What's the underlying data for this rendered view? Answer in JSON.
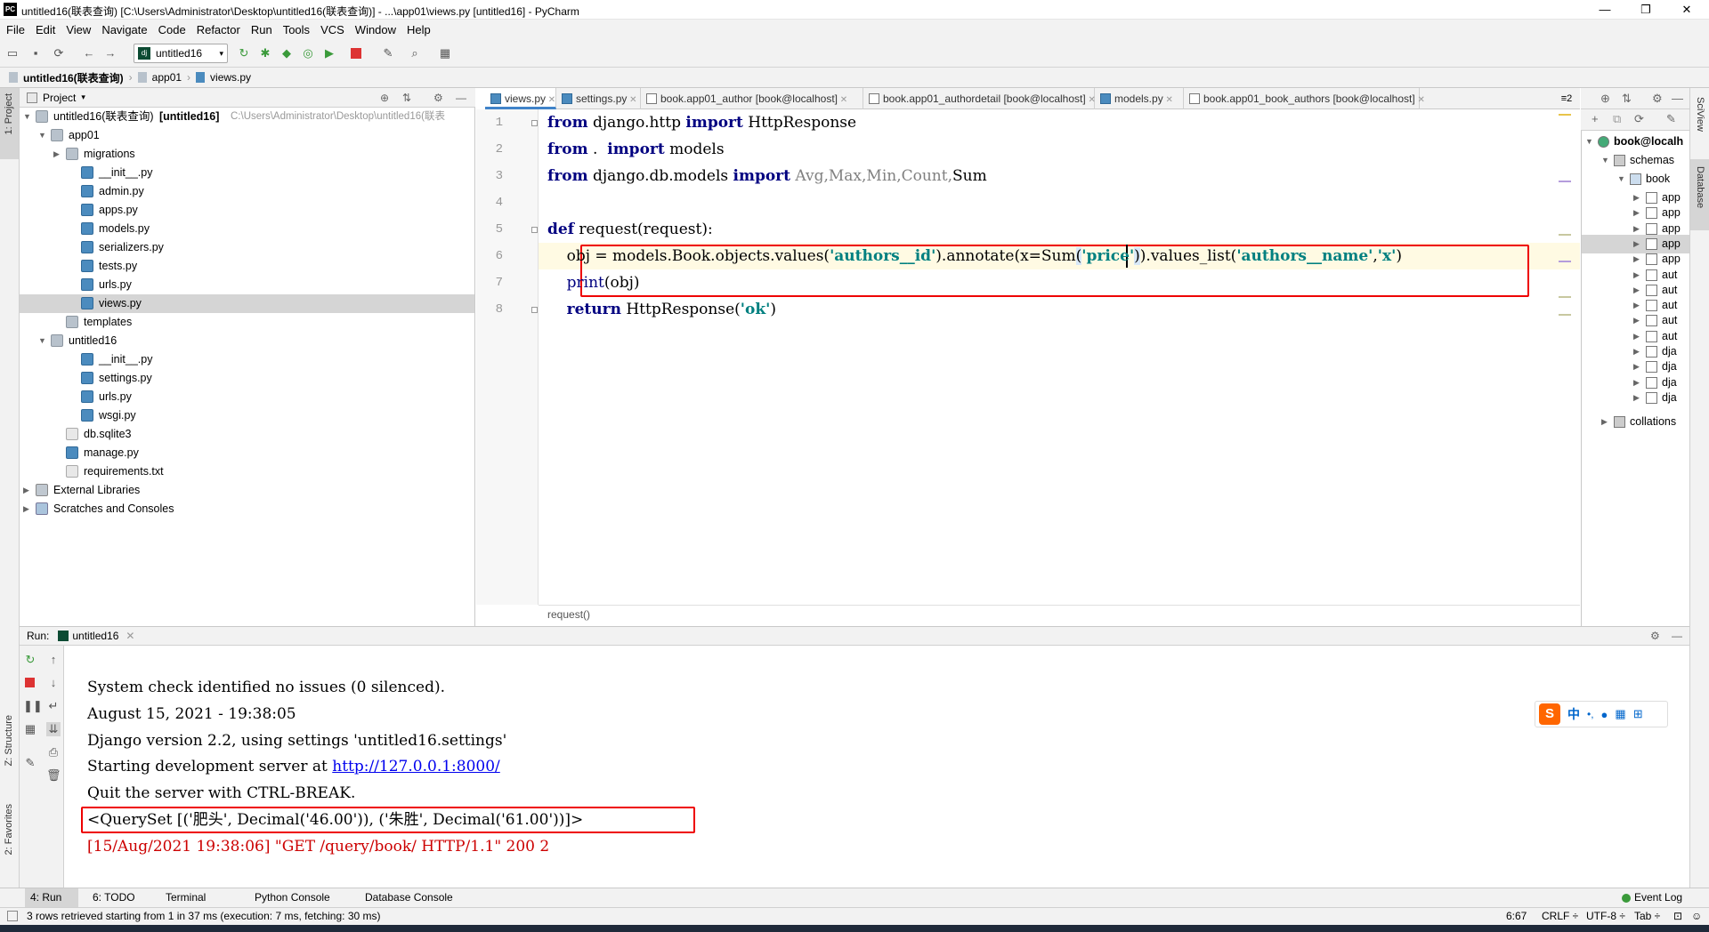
{
  "window": {
    "logo": "PC",
    "title": "untitled16(联表查询) [C:\\Users\\Administrator\\Desktop\\untitled16(联表查询)] - ...\\app01\\views.py [untitled16] - PyCharm",
    "minimize": "—",
    "restore": "❐",
    "close": "✕"
  },
  "menu": [
    "File",
    "Edit",
    "View",
    "Navigate",
    "Code",
    "Refactor",
    "Run",
    "Tools",
    "VCS",
    "Window",
    "Help"
  ],
  "toolbar": {
    "run_config": "untitled16"
  },
  "breadcrumb": {
    "items": [
      "untitled16(联表查询)",
      "app01",
      "views.py"
    ]
  },
  "left_strip": {
    "project": "1: Project",
    "structure": "Z: Structure",
    "favorites": "2: Favorites"
  },
  "right_strip": {
    "sciview": "SciView",
    "database": "Database"
  },
  "project_panel": {
    "header": "Project",
    "root_name": "untitled16(联表查询)",
    "root_bracket": "[untitled16]",
    "root_path": "C:\\Users\\Administrator\\Desktop\\untitled16(联表",
    "tree": [
      {
        "label": "app01",
        "depth": 1,
        "arrow": "v",
        "icon": "dir"
      },
      {
        "label": "migrations",
        "depth": 2,
        "arrow": ">",
        "icon": "dir"
      },
      {
        "label": "__init__.py",
        "depth": 3,
        "icon": "py"
      },
      {
        "label": "admin.py",
        "depth": 3,
        "icon": "py"
      },
      {
        "label": "apps.py",
        "depth": 3,
        "icon": "py"
      },
      {
        "label": "models.py",
        "depth": 3,
        "icon": "py"
      },
      {
        "label": "serializers.py",
        "depth": 3,
        "icon": "py"
      },
      {
        "label": "tests.py",
        "depth": 3,
        "icon": "py"
      },
      {
        "label": "urls.py",
        "depth": 3,
        "icon": "py"
      },
      {
        "label": "views.py",
        "depth": 3,
        "icon": "py",
        "selected": true
      },
      {
        "label": "templates",
        "depth": 2,
        "icon": "dir"
      },
      {
        "label": "untitled16",
        "depth": 1,
        "arrow": "v",
        "icon": "dir"
      },
      {
        "label": "__init__.py",
        "depth": 3,
        "icon": "py"
      },
      {
        "label": "settings.py",
        "depth": 3,
        "icon": "py"
      },
      {
        "label": "urls.py",
        "depth": 3,
        "icon": "py"
      },
      {
        "label": "wsgi.py",
        "depth": 3,
        "icon": "py"
      },
      {
        "label": "db.sqlite3",
        "depth": 2,
        "icon": "file"
      },
      {
        "label": "manage.py",
        "depth": 2,
        "icon": "py"
      },
      {
        "label": "requirements.txt",
        "depth": 2,
        "icon": "file"
      },
      {
        "label": "External Libraries",
        "depth": 0,
        "arrow": ">",
        "icon": "lib"
      },
      {
        "label": "Scratches and Consoles",
        "depth": 0,
        "arrow": ">",
        "icon": "scr"
      }
    ]
  },
  "editor_tabs": [
    {
      "label": "views.py",
      "active": true
    },
    {
      "label": "settings.py"
    },
    {
      "label": "book.app01_author [book@localhost]"
    },
    {
      "label": "book.app01_authordetail [book@localhost]"
    },
    {
      "label": "models.py"
    },
    {
      "label": "book.app01_book_authors [book@localhost]"
    }
  ],
  "tabs_overflow": "≡2",
  "editor": {
    "line_numbers": [
      "1",
      "2",
      "3",
      "4",
      "5",
      "6",
      "7",
      "8"
    ],
    "lines": [
      [
        {
          "t": "from",
          "c": "kw"
        },
        {
          "t": " django.http "
        },
        {
          "t": "import",
          "c": "kw"
        },
        {
          "t": " HttpResponse"
        }
      ],
      [
        {
          "t": "from",
          "c": "kw"
        },
        {
          "t": " .  "
        },
        {
          "t": "import",
          "c": "kw"
        },
        {
          "t": " models"
        }
      ],
      [
        {
          "t": "from",
          "c": "kw"
        },
        {
          "t": " django.db.models "
        },
        {
          "t": "import",
          "c": "kw"
        },
        {
          "t": " "
        },
        {
          "t": "Avg,Max,Min,Count,",
          "c": "gr"
        },
        {
          "t": "Sum"
        }
      ],
      [],
      [
        {
          "t": "def",
          "c": "kw"
        },
        {
          "t": " request(request):"
        }
      ],
      [
        {
          "t": "    obj = models.Book.objects.values("
        },
        {
          "t": "'authors__id'",
          "c": "str"
        },
        {
          "t": ").annotate(x=Sum"
        },
        {
          "t": "(",
          "c": "hl"
        },
        {
          "t": "'price'",
          "c": "str"
        },
        {
          "t": ")",
          "c": "hl"
        },
        {
          "t": ").values_list("
        },
        {
          "t": "'authors__name'",
          "c": "str"
        },
        {
          "t": ","
        },
        {
          "t": "'x'",
          "c": "str"
        },
        {
          "t": ")"
        }
      ],
      [
        {
          "t": "    "
        },
        {
          "t": "print",
          "c": "bi"
        },
        {
          "t": "(obj)"
        }
      ],
      [
        {
          "t": "    "
        },
        {
          "t": "return",
          "c": "kw"
        },
        {
          "t": " HttpResponse("
        },
        {
          "t": "'ok'",
          "c": "str"
        },
        {
          "t": ")"
        }
      ]
    ],
    "crumb": "request()"
  },
  "database": {
    "root": "book@localh",
    "schemas": "schemas",
    "book": "book",
    "tables": [
      "app",
      "app",
      "app",
      "app",
      "app",
      "aut",
      "aut",
      "aut",
      "aut",
      "aut",
      "dja",
      "dja",
      "dja",
      "dja"
    ],
    "collations": "collations"
  },
  "run": {
    "label": "Run:",
    "config": "untitled16",
    "console": {
      "l1": "System check identified no issues (0 silenced).",
      "l2": "August 15, 2021 - 19:38:05",
      "l3": "Django version 2.2, using settings 'untitled16.settings'",
      "l4_prefix": "Starting development server at ",
      "l4_link": "http://127.0.0.1:8000/",
      "l5": "Quit the server with CTRL-BREAK.",
      "l6": "<QuerySet [('肥头', Decimal('46.00')), ('朱胜', Decimal('61.00'))]>",
      "l7": "[15/Aug/2021 19:38:06] \"GET /query/book/ HTTP/1.1\" 200 2"
    }
  },
  "ime": {
    "logo": "S",
    "lang": "中",
    "punct": "•,"
  },
  "bottom_tabs": {
    "run": "4: Run",
    "todo": "6: TODO",
    "terminal": "Terminal",
    "python_console": "Python Console",
    "database_console": "Database Console",
    "event_log": "Event Log"
  },
  "status": {
    "message": "3 rows retrieved starting from 1 in 37 ms (execution: 7 ms, fetching: 30 ms)",
    "position": "6:67",
    "line_sep": "CRLF ÷",
    "encoding": "UTF-8 ÷",
    "indent": "Tab ÷"
  }
}
